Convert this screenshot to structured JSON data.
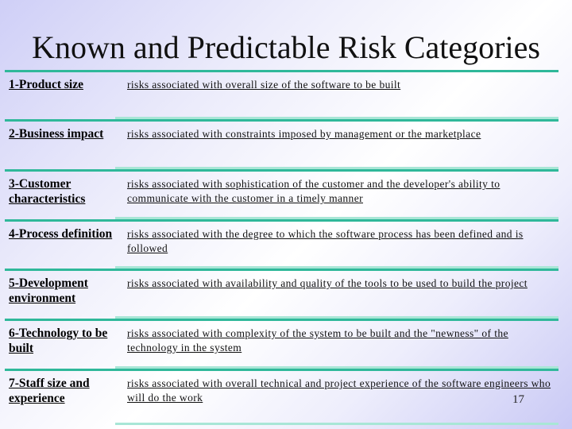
{
  "slide": {
    "title": "Known and Predictable Risk Categories",
    "page_number": "17",
    "accent_color": "#2fb89a",
    "accent_light_color": "#a8e6d6"
  },
  "categories": [
    {
      "label": "1-Product size",
      "description": "risks associated with overall size of the software to be built"
    },
    {
      "label": "2-Business impact",
      "description": "risks associated with constraints imposed by management or the marketplace"
    },
    {
      "label": "3-Customer characteristics",
      "description": "risks associated with sophistication of the customer and the developer's ability to communicate with the customer in a timely manner"
    },
    {
      "label": "4-Process definition",
      "description": "risks associated with the degree to which the software process has been defined and is followed"
    },
    {
      "label": "5-Development environment",
      "description": "risks associated with availability and quality of the tools to be used to build the project"
    },
    {
      "label": "6-Technology to be built",
      "description": "risks associated with complexity of the system to be built and the \"newness\" of the technology in the system"
    },
    {
      "label": "7-Staff size and experience",
      "description": "risks associated with overall technical and project experience of the software engineers who will do the work"
    }
  ]
}
